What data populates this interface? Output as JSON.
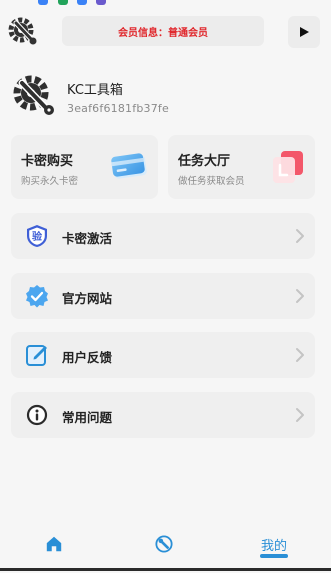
{
  "header": {
    "member_info": "会员信息：普通会员",
    "play_icon": "play-icon",
    "logo_icon": "wrench-gear-logo"
  },
  "profile": {
    "app_name": "KC工具箱",
    "device_id": "3eaf6f6181fb37fe",
    "avatar_icon": "wrench-gear-logo"
  },
  "cards": [
    {
      "title": "卡密购买",
      "subtitle": "购买永久卡密",
      "icon": "card-icon"
    },
    {
      "title": "任务大厅",
      "subtitle": "做任务获取会员",
      "icon": "task-icon"
    }
  ],
  "menu": [
    {
      "label": "卡密激活",
      "icon": "verify-shield-icon",
      "icon_char": "验"
    },
    {
      "label": "官方网站",
      "icon": "verified-badge-icon"
    },
    {
      "label": "用户反馈",
      "icon": "edit-icon"
    },
    {
      "label": "常用问题",
      "icon": "info-icon"
    }
  ],
  "tabs": {
    "home_icon": "home-icon",
    "tools_icon": "wrench-icon",
    "mine_label": "我的"
  },
  "colors": {
    "accent": "#2a8fd6",
    "member_red": "#e0262b",
    "card_bg": "#efefef",
    "page_bg": "#f6f6f6"
  }
}
